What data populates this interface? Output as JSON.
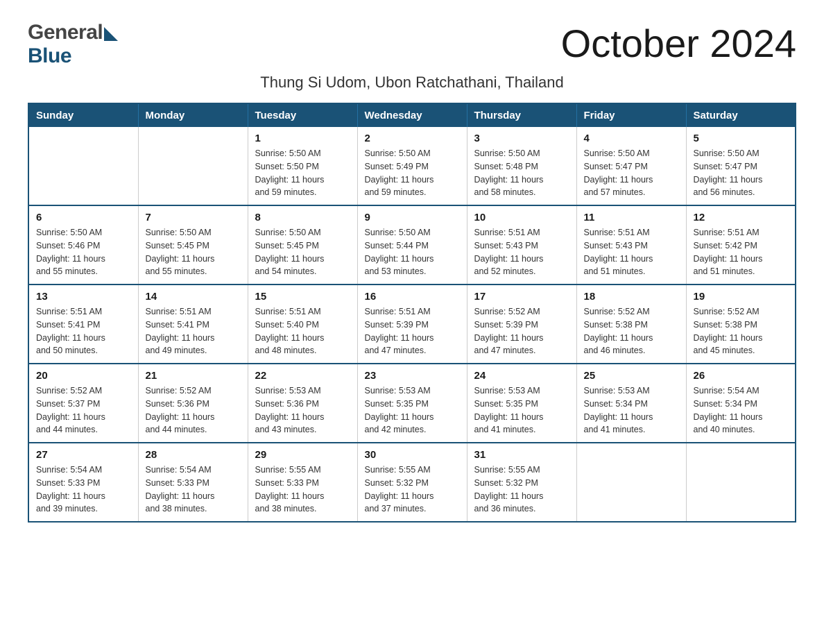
{
  "logo": {
    "general": "General",
    "blue": "Blue"
  },
  "header": {
    "month_year": "October 2024",
    "subtitle": "Thung Si Udom, Ubon Ratchathani, Thailand"
  },
  "calendar": {
    "days_of_week": [
      "Sunday",
      "Monday",
      "Tuesday",
      "Wednesday",
      "Thursday",
      "Friday",
      "Saturday"
    ],
    "weeks": [
      {
        "days": [
          {
            "number": "",
            "sunrise": "",
            "sunset": "",
            "daylight": ""
          },
          {
            "number": "",
            "sunrise": "",
            "sunset": "",
            "daylight": ""
          },
          {
            "number": "1",
            "sunrise": "Sunrise: 5:50 AM",
            "sunset": "Sunset: 5:50 PM",
            "daylight": "Daylight: 11 hours and 59 minutes."
          },
          {
            "number": "2",
            "sunrise": "Sunrise: 5:50 AM",
            "sunset": "Sunset: 5:49 PM",
            "daylight": "Daylight: 11 hours and 59 minutes."
          },
          {
            "number": "3",
            "sunrise": "Sunrise: 5:50 AM",
            "sunset": "Sunset: 5:48 PM",
            "daylight": "Daylight: 11 hours and 58 minutes."
          },
          {
            "number": "4",
            "sunrise": "Sunrise: 5:50 AM",
            "sunset": "Sunset: 5:47 PM",
            "daylight": "Daylight: 11 hours and 57 minutes."
          },
          {
            "number": "5",
            "sunrise": "Sunrise: 5:50 AM",
            "sunset": "Sunset: 5:47 PM",
            "daylight": "Daylight: 11 hours and 56 minutes."
          }
        ]
      },
      {
        "days": [
          {
            "number": "6",
            "sunrise": "Sunrise: 5:50 AM",
            "sunset": "Sunset: 5:46 PM",
            "daylight": "Daylight: 11 hours and 55 minutes."
          },
          {
            "number": "7",
            "sunrise": "Sunrise: 5:50 AM",
            "sunset": "Sunset: 5:45 PM",
            "daylight": "Daylight: 11 hours and 55 minutes."
          },
          {
            "number": "8",
            "sunrise": "Sunrise: 5:50 AM",
            "sunset": "Sunset: 5:45 PM",
            "daylight": "Daylight: 11 hours and 54 minutes."
          },
          {
            "number": "9",
            "sunrise": "Sunrise: 5:50 AM",
            "sunset": "Sunset: 5:44 PM",
            "daylight": "Daylight: 11 hours and 53 minutes."
          },
          {
            "number": "10",
            "sunrise": "Sunrise: 5:51 AM",
            "sunset": "Sunset: 5:43 PM",
            "daylight": "Daylight: 11 hours and 52 minutes."
          },
          {
            "number": "11",
            "sunrise": "Sunrise: 5:51 AM",
            "sunset": "Sunset: 5:43 PM",
            "daylight": "Daylight: 11 hours and 51 minutes."
          },
          {
            "number": "12",
            "sunrise": "Sunrise: 5:51 AM",
            "sunset": "Sunset: 5:42 PM",
            "daylight": "Daylight: 11 hours and 51 minutes."
          }
        ]
      },
      {
        "days": [
          {
            "number": "13",
            "sunrise": "Sunrise: 5:51 AM",
            "sunset": "Sunset: 5:41 PM",
            "daylight": "Daylight: 11 hours and 50 minutes."
          },
          {
            "number": "14",
            "sunrise": "Sunrise: 5:51 AM",
            "sunset": "Sunset: 5:41 PM",
            "daylight": "Daylight: 11 hours and 49 minutes."
          },
          {
            "number": "15",
            "sunrise": "Sunrise: 5:51 AM",
            "sunset": "Sunset: 5:40 PM",
            "daylight": "Daylight: 11 hours and 48 minutes."
          },
          {
            "number": "16",
            "sunrise": "Sunrise: 5:51 AM",
            "sunset": "Sunset: 5:39 PM",
            "daylight": "Daylight: 11 hours and 47 minutes."
          },
          {
            "number": "17",
            "sunrise": "Sunrise: 5:52 AM",
            "sunset": "Sunset: 5:39 PM",
            "daylight": "Daylight: 11 hours and 47 minutes."
          },
          {
            "number": "18",
            "sunrise": "Sunrise: 5:52 AM",
            "sunset": "Sunset: 5:38 PM",
            "daylight": "Daylight: 11 hours and 46 minutes."
          },
          {
            "number": "19",
            "sunrise": "Sunrise: 5:52 AM",
            "sunset": "Sunset: 5:38 PM",
            "daylight": "Daylight: 11 hours and 45 minutes."
          }
        ]
      },
      {
        "days": [
          {
            "number": "20",
            "sunrise": "Sunrise: 5:52 AM",
            "sunset": "Sunset: 5:37 PM",
            "daylight": "Daylight: 11 hours and 44 minutes."
          },
          {
            "number": "21",
            "sunrise": "Sunrise: 5:52 AM",
            "sunset": "Sunset: 5:36 PM",
            "daylight": "Daylight: 11 hours and 44 minutes."
          },
          {
            "number": "22",
            "sunrise": "Sunrise: 5:53 AM",
            "sunset": "Sunset: 5:36 PM",
            "daylight": "Daylight: 11 hours and 43 minutes."
          },
          {
            "number": "23",
            "sunrise": "Sunrise: 5:53 AM",
            "sunset": "Sunset: 5:35 PM",
            "daylight": "Daylight: 11 hours and 42 minutes."
          },
          {
            "number": "24",
            "sunrise": "Sunrise: 5:53 AM",
            "sunset": "Sunset: 5:35 PM",
            "daylight": "Daylight: 11 hours and 41 minutes."
          },
          {
            "number": "25",
            "sunrise": "Sunrise: 5:53 AM",
            "sunset": "Sunset: 5:34 PM",
            "daylight": "Daylight: 11 hours and 41 minutes."
          },
          {
            "number": "26",
            "sunrise": "Sunrise: 5:54 AM",
            "sunset": "Sunset: 5:34 PM",
            "daylight": "Daylight: 11 hours and 40 minutes."
          }
        ]
      },
      {
        "days": [
          {
            "number": "27",
            "sunrise": "Sunrise: 5:54 AM",
            "sunset": "Sunset: 5:33 PM",
            "daylight": "Daylight: 11 hours and 39 minutes."
          },
          {
            "number": "28",
            "sunrise": "Sunrise: 5:54 AM",
            "sunset": "Sunset: 5:33 PM",
            "daylight": "Daylight: 11 hours and 38 minutes."
          },
          {
            "number": "29",
            "sunrise": "Sunrise: 5:55 AM",
            "sunset": "Sunset: 5:33 PM",
            "daylight": "Daylight: 11 hours and 38 minutes."
          },
          {
            "number": "30",
            "sunrise": "Sunrise: 5:55 AM",
            "sunset": "Sunset: 5:32 PM",
            "daylight": "Daylight: 11 hours and 37 minutes."
          },
          {
            "number": "31",
            "sunrise": "Sunrise: 5:55 AM",
            "sunset": "Sunset: 5:32 PM",
            "daylight": "Daylight: 11 hours and 36 minutes."
          },
          {
            "number": "",
            "sunrise": "",
            "sunset": "",
            "daylight": ""
          },
          {
            "number": "",
            "sunrise": "",
            "sunset": "",
            "daylight": ""
          }
        ]
      }
    ]
  }
}
